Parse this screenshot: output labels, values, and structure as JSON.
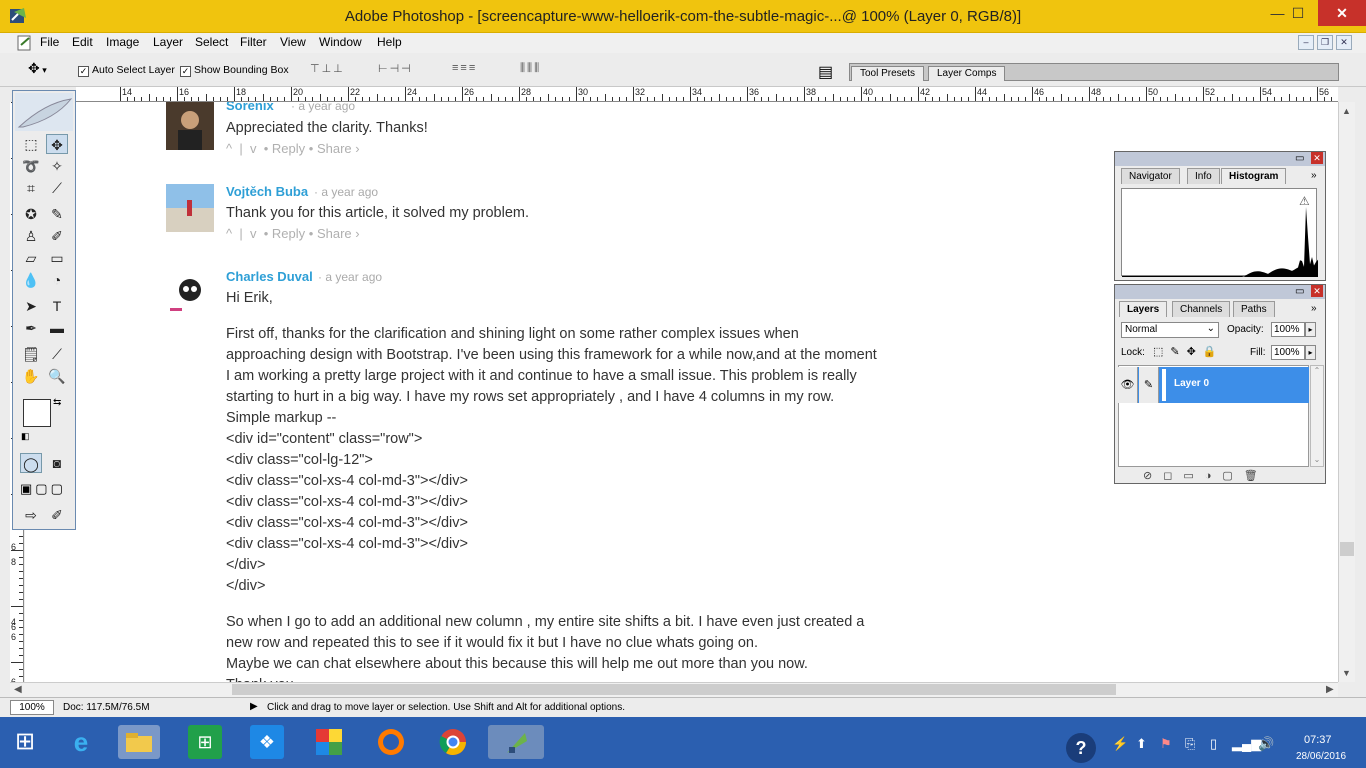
{
  "window": {
    "title": "Adobe Photoshop - [screencapture-www-helloerik-com-the-subtle-magic-...@ 100% (Layer 0, RGB/8)]",
    "min_label": "—",
    "max_label": "☐",
    "close_label": "✕"
  },
  "menu": [
    "File",
    "Edit",
    "Image",
    "Layer",
    "Select",
    "Filter",
    "View",
    "Window",
    "Help"
  ],
  "doc_controls": [
    "–",
    "❐",
    "✕"
  ],
  "options": {
    "auto_select_label": "Auto Select Layer",
    "auto_select_checked": true,
    "bounding_box_label": "Show Bounding Box",
    "bounding_box_checked": true,
    "wells": [
      "Tool Presets",
      "Layer Comps"
    ]
  },
  "ruler": {
    "h_labels": [
      "14",
      "16",
      "18",
      "20",
      "22",
      "24",
      "26",
      "28",
      "30",
      "32",
      "34",
      "36",
      "38",
      "40",
      "42",
      "44",
      "46",
      "48",
      "50",
      "52",
      "54",
      "56"
    ],
    "v_labels": [
      "6",
      "8",
      "4",
      "6",
      "6",
      "6"
    ]
  },
  "comments": [
    {
      "name": "Sorenix",
      "date": "a year ago",
      "lines": [
        "Appreciated the clarity. Thanks!"
      ],
      "actions": [
        "^",
        "|",
        "v",
        "•",
        "Reply",
        "•",
        "Share ›"
      ]
    },
    {
      "name": "Vojtěch Buba",
      "date": "a year ago",
      "lines": [
        "Thank you for this article, it solved my problem."
      ],
      "actions": [
        "^",
        "|",
        "v",
        "•",
        "Reply",
        "•",
        "Share ›"
      ]
    },
    {
      "name": "Charles Duval",
      "date": "a year ago",
      "greeting": "Hi Erik,",
      "para1": [
        "First off, thanks for the clarification and shining light on some rather complex issues when",
        "approaching design with Bootstrap. I've been using this framework for a while now,and at the moment",
        "I am working a pretty large project with it and continue to have a small issue. This problem is really",
        "starting to hurt in a big way. I have my rows set appropriately , and I have 4 columns in my row.",
        "Simple markup --",
        "<div id=\"content\" class=\"row\">",
        "<div class=\"col-lg-12\">",
        "<div class=\"col-xs-4 col-md-3\"></div>",
        "<div class=\"col-xs-4 col-md-3\"></div>",
        "<div class=\"col-xs-4 col-md-3\"></div>",
        "<div class=\"col-xs-4 col-md-3\"></div>",
        "</div>",
        "</div>"
      ],
      "para2": [
        "So when I go to add an additional new column , my entire site shifts a bit. I have even just created a",
        "new row and repeated this to see if it would fix it but I have no clue whats going on.",
        "Maybe we can chat elsewhere about this because this will help me out more than you now.",
        "Thank you"
      ]
    }
  ],
  "navigator_panel": {
    "tabs": [
      "Navigator",
      "Info",
      "Histogram"
    ],
    "active": "Histogram",
    "warning_icon": "⚠"
  },
  "layers_panel": {
    "tabs": [
      "Layers",
      "Channels",
      "Paths"
    ],
    "active": "Layers",
    "blend_mode": "Normal",
    "opacity_label": "Opacity:",
    "opacity": "100%",
    "lock_label": "Lock:",
    "fill_label": "Fill:",
    "fill": "100%",
    "layer_name": "Layer 0"
  },
  "status": {
    "zoom": "100%",
    "doc": "Doc: 117.5M/76.5M",
    "hint": "Click and drag to move layer or selection.  Use Shift and Alt for additional options."
  },
  "tray": {
    "time": "07:37",
    "date": "28/06/2016"
  },
  "colors": {
    "titlebar": "#f0c40e",
    "taskbar": "#2b5fb0",
    "link_blue": "#2e9fd6",
    "layer_selected": "#3d8ee8"
  }
}
